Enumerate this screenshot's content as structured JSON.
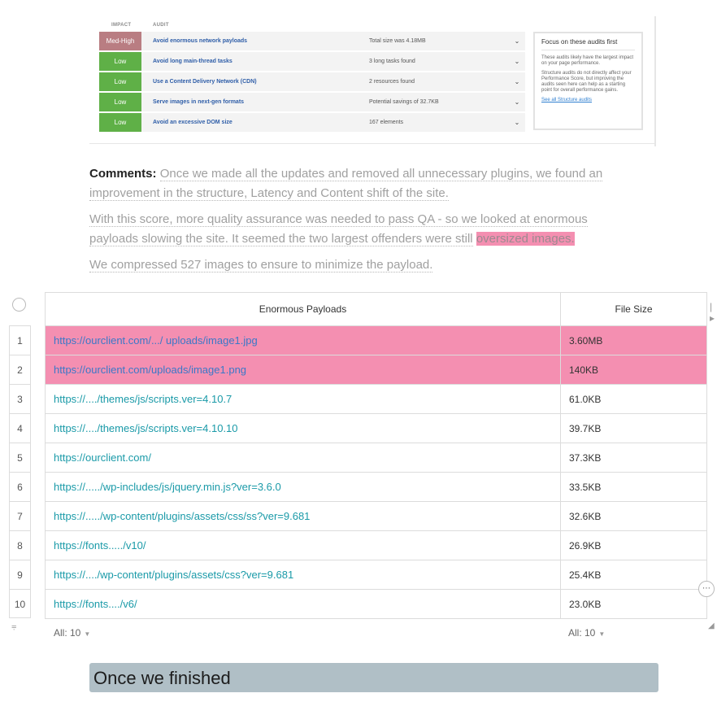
{
  "audit_panel": {
    "col_impact": "IMPACT",
    "col_audit": "AUDIT",
    "rows": [
      {
        "impact": "Med-High",
        "impact_color": "#b97d82",
        "name": "Avoid enormous network payloads",
        "detail": "Total size was 4.18MB"
      },
      {
        "impact": "Low",
        "impact_color": "#5fb047",
        "name": "Avoid long main-thread tasks",
        "detail": "3 long tasks found"
      },
      {
        "impact": "Low",
        "impact_color": "#5fb047",
        "name": "Use a Content Delivery Network (CDN)",
        "detail": "2 resources found"
      },
      {
        "impact": "Low",
        "impact_color": "#5fb047",
        "name": "Serve images in next-gen formats",
        "detail": "Potential savings of 32.7KB"
      },
      {
        "impact": "Low",
        "impact_color": "#5fb047",
        "name": "Avoid an excessive DOM size",
        "detail": "167 elements"
      }
    ],
    "focus": {
      "title": "Focus on these audits first",
      "p1": "These audits likely have the largest impact on your page performance.",
      "p2": "Structure audits do not directly affect your Performance Score, but improving the audits seen here can help as a starting point for overall performance gains.",
      "link": "See all Structure audits"
    }
  },
  "comments": {
    "label": "Comments:",
    "p1_line1": "Once we made all the updates and removed all unnecessary plugins, we found an",
    "p1_line2": "improvement in the structure, Latency and Content shift of the site.",
    "p2_line1": "With this score, more quality assurance was needed to pass QA - so we looked at enormous",
    "p2_line2": "payloads slowing the site. It seemed the two largest offenders were still",
    "p2_highlight": "oversized images.",
    "p3": "We compressed 527 images to ensure to minimize the payload."
  },
  "table": {
    "headers": [
      "Enormous Payloads",
      "File Size"
    ],
    "rows": [
      {
        "num": "1",
        "url": "https://ourclient.com/.../ uploads/image1.jpg",
        "size": "3.60MB",
        "highlight": true
      },
      {
        "num": "2",
        "url": "https://ourclient.com/uploads/image1.png",
        "size": "140KB",
        "highlight": true
      },
      {
        "num": "3",
        "url": "https://..../themes/js/scripts.ver=4.10.7",
        "size": "61.0KB",
        "highlight": false
      },
      {
        "num": "4",
        "url": "https://..../themes/js/scripts.ver=4.10.10",
        "size": "39.7KB",
        "highlight": false
      },
      {
        "num": "5",
        "url": "https://ourclient.com/",
        "size": "37.3KB",
        "highlight": false
      },
      {
        "num": "6",
        "url": "https://...../wp-includes/js/jquery.min.js?ver=3.6.0",
        "size": "33.5KB",
        "highlight": false
      },
      {
        "num": "7",
        "url": "https://...../wp-content/plugins/assets/css/ss?ver=9.681",
        "size": "32.6KB",
        "highlight": false
      },
      {
        "num": "8",
        "url": "https://fonts...../v10/",
        "size": "26.9KB",
        "highlight": false
      },
      {
        "num": "9",
        "url": "https://..../wp-content/plugins/assets/css?ver=9.681",
        "size": "25.4KB",
        "highlight": false
      },
      {
        "num": "10",
        "url": "https://fonts..../v6/",
        "size": "23.0KB",
        "highlight": false
      }
    ],
    "footer_left": "All: 10",
    "footer_right": "All: 10",
    "highlight_color": "#f48fb1"
  },
  "heading": "Once we finished"
}
